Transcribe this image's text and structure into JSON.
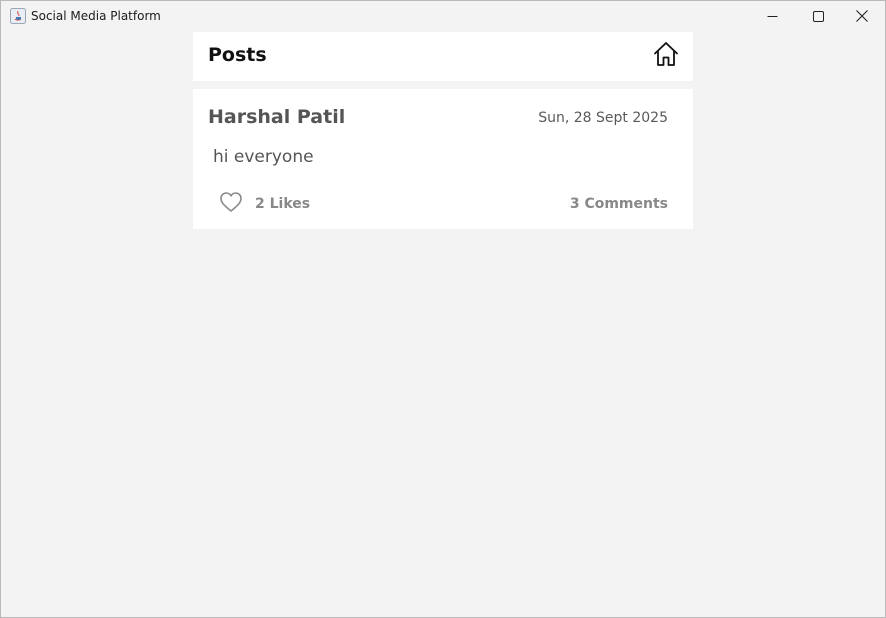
{
  "window": {
    "title": "Social Media Platform",
    "app_icon": "java-app-icon",
    "controls": [
      "minimize-icon",
      "maximize-icon",
      "close-icon"
    ]
  },
  "header": {
    "title": "Posts",
    "home_icon": "home-icon"
  },
  "posts": [
    {
      "author": "Harshal Patil",
      "date": "Sun, 28 Sept 2025",
      "body": "hi everyone",
      "like_icon": "heart-outline-icon",
      "likes_label": "2 Likes",
      "comments_label": "3 Comments"
    }
  ],
  "colors": {
    "background": "#f3f3f3",
    "panel": "#ffffff",
    "author_text": "#555555",
    "meta_text": "#888888"
  }
}
